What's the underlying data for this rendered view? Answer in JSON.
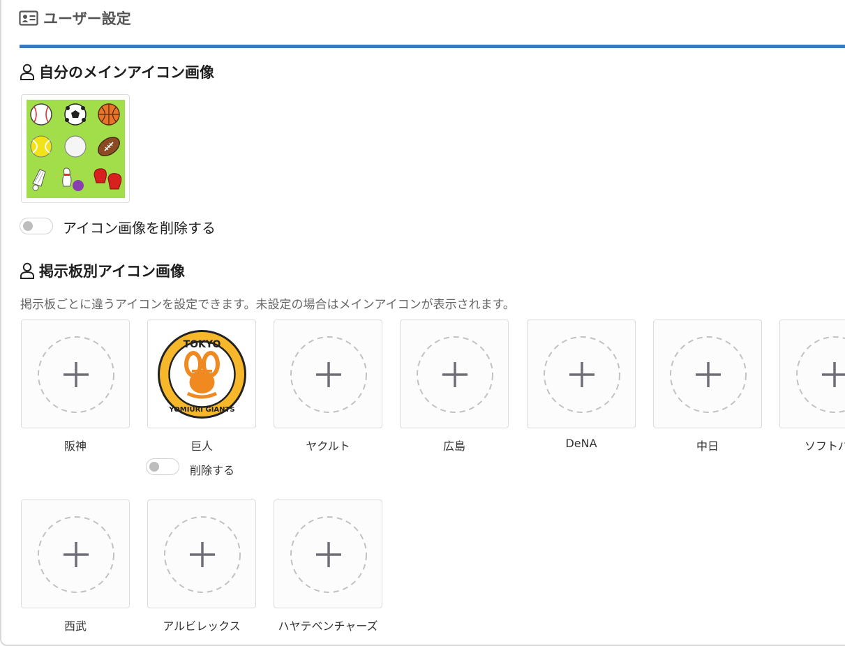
{
  "header": {
    "title": "ユーザー設定",
    "icon": "id-card-icon"
  },
  "main_icon_section": {
    "title": "自分のメインアイコン画像",
    "icon": "user-icon",
    "image_alt": "sports balls illustration",
    "delete_toggle": {
      "label": "アイコン画像を削除する",
      "on": false
    }
  },
  "board_icon_section": {
    "title": "掲示板別アイコン画像",
    "icon": "user-icon",
    "description": "掲示板ごとに違うアイコンを設定できます。未設定の場合はメインアイコンが表示されます。",
    "boards": [
      {
        "label": "阪神",
        "has_image": false
      },
      {
        "label": "巨人",
        "has_image": true,
        "delete_label": "削除する",
        "delete_on": false
      },
      {
        "label": "ヤクルト",
        "has_image": false
      },
      {
        "label": "広島",
        "has_image": false
      },
      {
        "label": "DeNA",
        "has_image": false
      },
      {
        "label": "中日",
        "has_image": false
      },
      {
        "label": "ソフトバン",
        "has_image": false
      },
      {
        "label": "西武",
        "has_image": false
      },
      {
        "label": "アルビレックス",
        "has_image": false
      },
      {
        "label": "ハヤテベンチャーズ",
        "has_image": false
      }
    ],
    "giants_logo_text": {
      "top": "TOKYO",
      "bottom": "YOMIURI GIANTS"
    }
  },
  "colors": {
    "accent": "#3c77bf",
    "toggle_off": "#bdbdbd",
    "tile_border": "#dcdcdc",
    "plus": "#6e6e76"
  }
}
